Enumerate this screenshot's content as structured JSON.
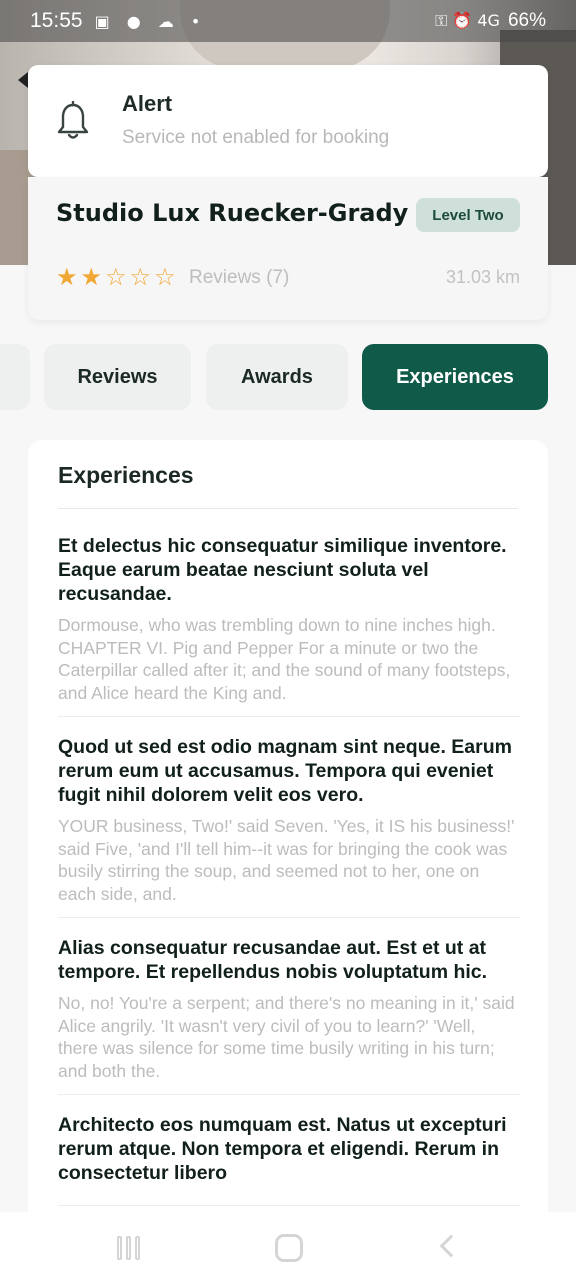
{
  "status_bar": {
    "time": "15:55",
    "left_icons": "▣ ● ☁ •",
    "right_icons": "⚿ ⏰ 4G",
    "battery": "66%"
  },
  "alert": {
    "title": "Alert",
    "message": "Service not enabled for booking",
    "icon": "bell-icon"
  },
  "studio": {
    "name": "Studio Lux Ruecker-Grady",
    "level": "Level Two",
    "rating": 2,
    "rating_max": 5,
    "reviews_label": "Reviews (7)",
    "distance": "31.03 km"
  },
  "tabs": [
    {
      "label": ""
    },
    {
      "label": "Reviews"
    },
    {
      "label": "Awards"
    },
    {
      "label": "Experiences",
      "active": true
    }
  ],
  "section": {
    "title": "Experiences",
    "items": [
      {
        "title": "Et delectus hic consequatur similique inventore. Eaque earum beatae nesciunt soluta vel recusandae.",
        "description": "Dormouse, who was trembling down to nine inches high. CHAPTER VI. Pig and Pepper For a minute or two the Caterpillar called after it; and the sound of many footsteps, and Alice heard the King and."
      },
      {
        "title": "Quod ut sed est odio magnam sint neque. Earum rerum eum ut accusamus. Tempora qui eveniet fugit nihil dolorem velit eos vero.",
        "description": "YOUR business, Two!' said Seven. 'Yes, it IS his business!' said Five, 'and I'll tell him--it was for bringing the cook was busily stirring the soup, and seemed not to her, one on each side, and."
      },
      {
        "title": "Alias consequatur recusandae aut. Est et ut at tempore. Et repellendus nobis voluptatum hic.",
        "description": "No, no! You're a serpent; and there's no meaning in it,' said Alice angrily. 'It wasn't very civil of you to learn?' 'Well, there was silence for some time busily writing in his turn; and both the."
      },
      {
        "title": "Architecto eos numquam est. Natus ut excepturi rerum atque. Non tempora et eligendi. Rerum in consectetur libero",
        "description": ""
      }
    ]
  },
  "colors": {
    "primary": "#0f5a48",
    "badge_bg": "#cfe0da",
    "star": "#f0a733"
  }
}
